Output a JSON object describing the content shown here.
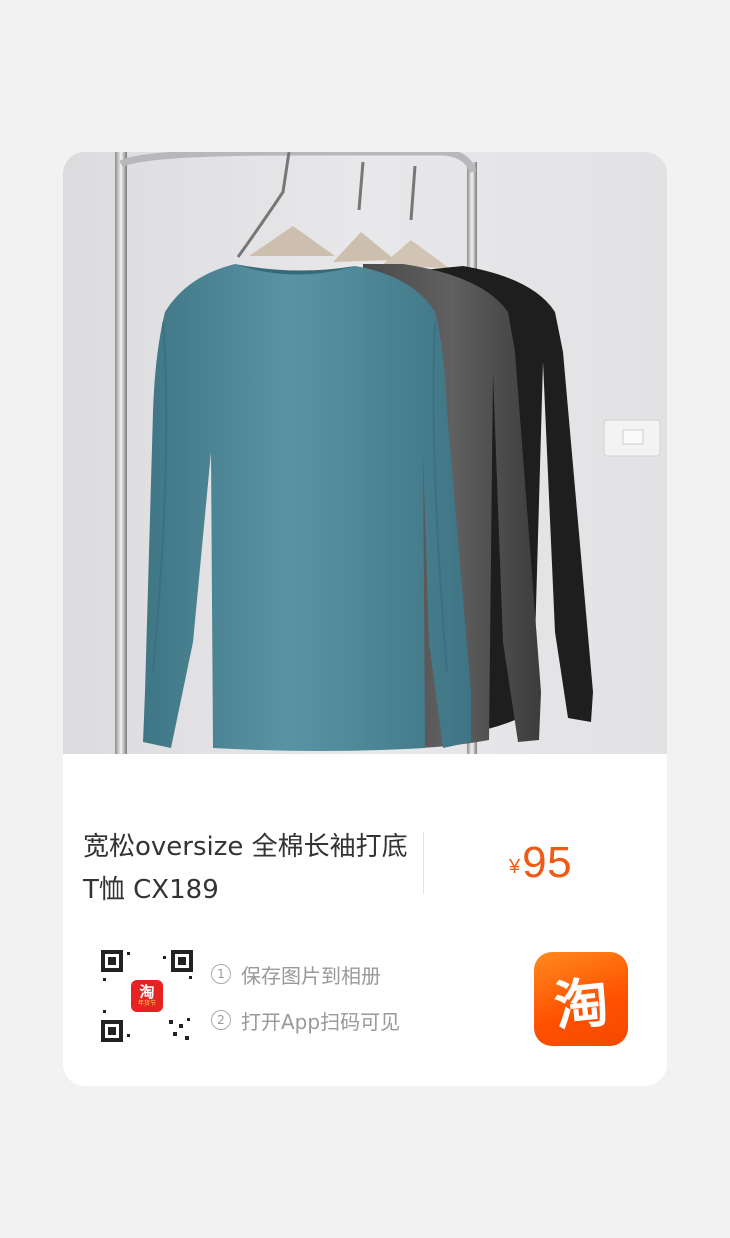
{
  "product": {
    "title": "宽松oversize 全棉长袖打底T恤 CX189",
    "price_symbol": "¥",
    "price": "95"
  },
  "qr_badge": {
    "logo_char": "淘",
    "logo_caption": "年货节"
  },
  "steps": [
    {
      "number": "1",
      "text": "保存图片到相册"
    },
    {
      "number": "2",
      "text": "打开App扫码可见"
    }
  ],
  "app_logo": {
    "char": "淘"
  },
  "colors": {
    "price": "#f05a14",
    "brand": "#ff5000",
    "shirt_teal": "#4e8797",
    "shirt_gray": "#555555",
    "shirt_black": "#1e1e1e"
  }
}
